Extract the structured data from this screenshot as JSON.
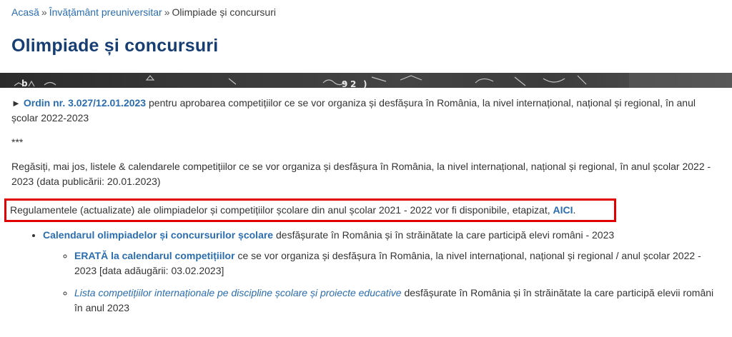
{
  "breadcrumb": {
    "items": [
      "Acasă",
      "Învățământ preuniversitar"
    ],
    "current": "Olimpiade și concursuri",
    "separator": "»"
  },
  "page_title": "Olimpiade și concursuri",
  "content": {
    "ordin": {
      "arrow": "►",
      "link": "Ordin nr. 3.027/12.01.2023",
      "text": " pentru aprobarea competițiilor ce se vor organiza și desfășura în România, la nivel internațional, național și regional, în anul școlar 2022-2023"
    },
    "stars": "***",
    "intro": "Regăsiți, mai jos, listele & calendarele competițiilor ce se vor organiza și desfășura în România, la nivel internațional, național și regional, în anul școlar 2022 - 2023 (data publicării: 20.01.2023)",
    "regulamente": {
      "text": "Regulamentele (actualizate) ale olimpiadelor și competițiilor școlare din anul școlar 2021 - 2022 vor fi disponibile, etapizat, ",
      "link": "AICI",
      "end": "."
    },
    "list": {
      "item1_link": "Calendarul olimpiadelor și concursurilor școlare",
      "item1_text": " desfășurate în România și în străinătate la care participă elevi români - 2023",
      "sub1_link": "ERATĂ la calendarul competițiilor",
      "sub1_text": " ce se vor organiza și desfășura în România, la nivel internațional, național și regional / anul școlar 2022 - 2023 [data adăugării: 03.02.2023]",
      "sub2_link": "Lista competițiilor internaționale pe discipline școlare și proiecte educative",
      "sub2_text": " desfășurate în România și în străinătate la care participă elevii români în anul 2023"
    }
  },
  "colors": {
    "title": "#173e72",
    "link": "#2a6db0",
    "highlight_box": "#e00000"
  }
}
